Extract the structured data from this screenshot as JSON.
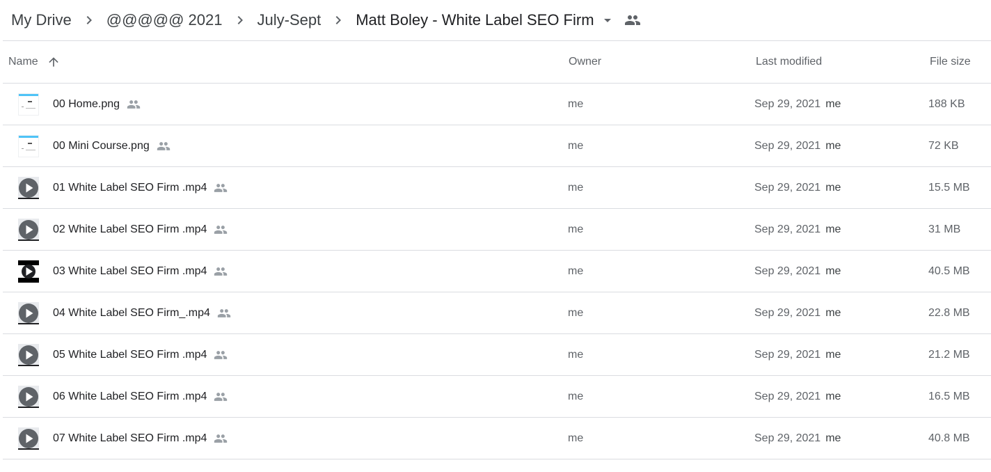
{
  "breadcrumb": {
    "items": [
      "My Drive",
      "@@@@@ 2021",
      "July-Sept"
    ],
    "current": "Matt Boley - White Label SEO Firm"
  },
  "columns": {
    "name": "Name",
    "owner": "Owner",
    "last_modified": "Last modified",
    "file_size": "File size"
  },
  "files": [
    {
      "name": "00 Home.png",
      "type": "image",
      "owner": "me",
      "modified": "Sep 29, 2021",
      "modified_by": "me",
      "size": "188 KB"
    },
    {
      "name": "00 Mini Course.png",
      "type": "image",
      "owner": "me",
      "modified": "Sep 29, 2021",
      "modified_by": "me",
      "size": "72 KB"
    },
    {
      "name": "01 White Label SEO Firm .mp4",
      "type": "video",
      "owner": "me",
      "modified": "Sep 29, 2021",
      "modified_by": "me",
      "size": "15.5 MB"
    },
    {
      "name": "02 White Label SEO Firm .mp4",
      "type": "video",
      "owner": "me",
      "modified": "Sep 29, 2021",
      "modified_by": "me",
      "size": "31 MB"
    },
    {
      "name": "03 White Label SEO Firm .mp4",
      "type": "video-dark",
      "owner": "me",
      "modified": "Sep 29, 2021",
      "modified_by": "me",
      "size": "40.5 MB"
    },
    {
      "name": "04 White Label SEO Firm_.mp4",
      "type": "video",
      "owner": "me",
      "modified": "Sep 29, 2021",
      "modified_by": "me",
      "size": "22.8 MB"
    },
    {
      "name": "05 White Label SEO Firm .mp4",
      "type": "video",
      "owner": "me",
      "modified": "Sep 29, 2021",
      "modified_by": "me",
      "size": "21.2 MB"
    },
    {
      "name": "06 White Label SEO Firm .mp4",
      "type": "video",
      "owner": "me",
      "modified": "Sep 29, 2021",
      "modified_by": "me",
      "size": "16.5 MB"
    },
    {
      "name": "07 White Label SEO Firm .mp4",
      "type": "video",
      "owner": "me",
      "modified": "Sep 29, 2021",
      "modified_by": "me",
      "size": "40.8 MB"
    }
  ],
  "icons": {
    "breadcrumb_separator": "chevron-right-icon",
    "breadcrumb_dropdown": "arrow-drop-down-icon",
    "shared_folder": "people-icon",
    "sort": "arrow-upward-icon",
    "shared_file": "people-icon",
    "video_play": "play-circle-icon"
  },
  "colors": {
    "text": "#202124",
    "secondary": "#5f6368",
    "divider": "#dadce0",
    "icon": "#9aa0a6"
  }
}
